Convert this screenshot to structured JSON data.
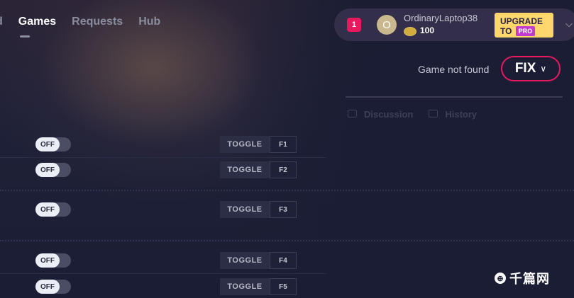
{
  "nav": {
    "tabs": [
      "d",
      "Games",
      "Requests",
      "Hub"
    ],
    "active": "Games"
  },
  "userbar": {
    "notification_count": "1",
    "avatar_letter": "O",
    "username": "OrdinaryLaptop38",
    "coins": "100",
    "upgrade_line1": "UPGRADE",
    "upgrade_to": "TO",
    "upgrade_pro": "PRO"
  },
  "status": {
    "game_not_found": "Game not found",
    "fix_label": "FIX"
  },
  "panel_tabs": [
    "Discussion",
    "History"
  ],
  "cheats": [
    {
      "state": "OFF",
      "action": "TOGGLE",
      "key": "F1"
    },
    {
      "state": "OFF",
      "action": "TOGGLE",
      "key": "F2"
    },
    {
      "state": "OFF",
      "action": "TOGGLE",
      "key": "F3"
    },
    {
      "state": "OFF",
      "action": "TOGGLE",
      "key": "F4"
    },
    {
      "state": "OFF",
      "action": "TOGGLE",
      "key": "F5"
    }
  ],
  "watermark": {
    "text": "千篇网"
  },
  "colors": {
    "accent_pink": "#e8195e",
    "upgrade_yellow": "#ffd76c",
    "pro_purple": "#c23cd0",
    "background": "#1a1d33"
  }
}
